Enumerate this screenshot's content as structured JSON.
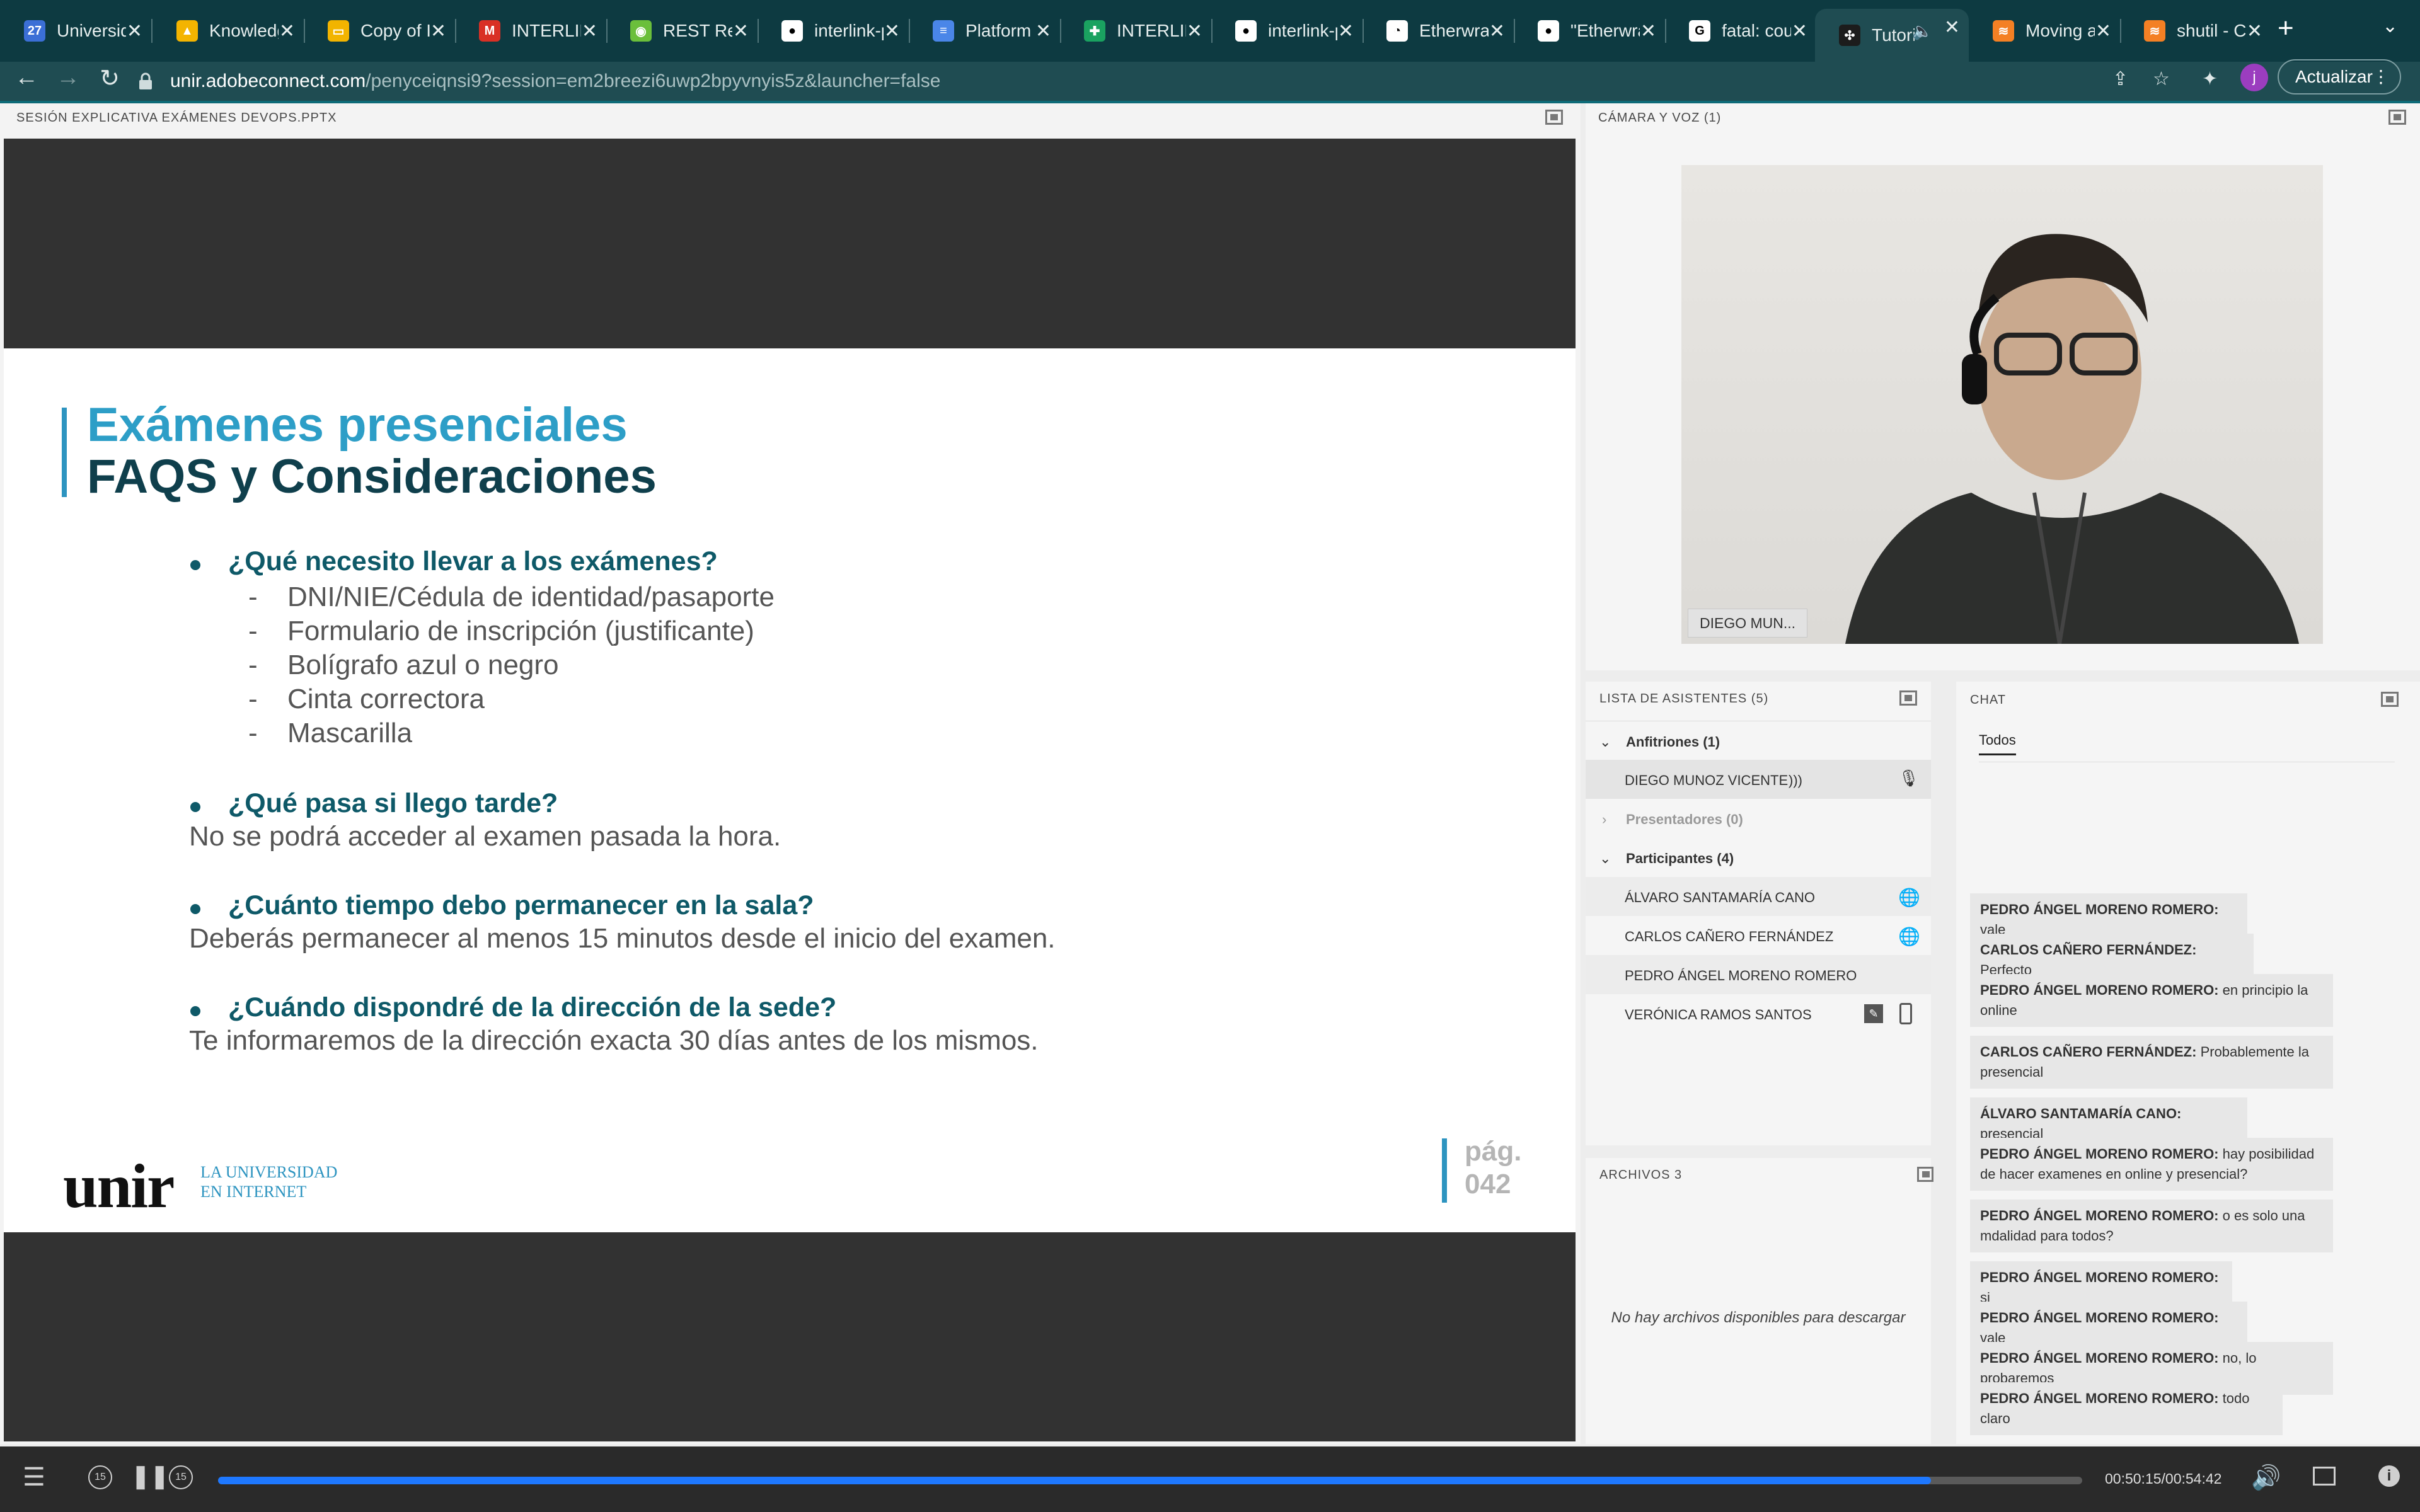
{
  "browser": {
    "tabs": [
      {
        "title": "Universidad",
        "color": "#3b6fd6",
        "glyph": "27"
      },
      {
        "title": "Knowledge",
        "color": "#f4b400",
        "glyph": "▲"
      },
      {
        "title": "Copy of ID",
        "color": "#f2b400",
        "glyph": "▭"
      },
      {
        "title": "INTERLINK",
        "color": "#d93025",
        "glyph": "M"
      },
      {
        "title": "REST Res",
        "color": "#6bbf3b",
        "glyph": "◉"
      },
      {
        "title": "interlink-p",
        "color": "#ffffff",
        "glyph": "●"
      },
      {
        "title": "Platform",
        "color": "#4a86e8",
        "glyph": "≡"
      },
      {
        "title": "INTERLINK",
        "color": "#1aa260",
        "glyph": "✚"
      },
      {
        "title": "interlink-p",
        "color": "#ffffff",
        "glyph": "●"
      },
      {
        "title": "Etherwrap",
        "color": "#ffffff",
        "glyph": "◔"
      },
      {
        "title": "\"Etherwra",
        "color": "#ffffff",
        "glyph": "●"
      },
      {
        "title": "fatal: cou",
        "color": "#ffffff",
        "glyph": "G"
      },
      {
        "title": "Tutoria",
        "color": "#1c1c1c",
        "glyph": "✣",
        "active": true
      },
      {
        "title": "Moving al",
        "color": "#f48024",
        "glyph": "≋"
      },
      {
        "title": "shutil - C",
        "color": "#f48024",
        "glyph": "≋"
      }
    ],
    "close_glyph": "✕",
    "new_tab_glyph": "+",
    "url_host": "unir.adobeconnect.com",
    "url_path": "/penyceiqnsi9?session=em2breezi6uwp2bpyvnyis5z&launcher=false",
    "avatar_letter": "j",
    "update_label": "Actualizar"
  },
  "slide_panel": {
    "title": "SESIÓN EXPLICATIVA EXÁMENES DEVOPS.PPTX"
  },
  "slide": {
    "title1": "Exámenes presenciales",
    "title2": "FAQS y Consideraciones",
    "q1": "¿Qué necesito llevar a los exámenes?",
    "items": [
      "DNI/NIE/Cédula de identidad/pasaporte",
      "Formulario de inscripción (justificante)",
      "Bolígrafo azul o negro",
      "Cinta correctora",
      "Mascarilla"
    ],
    "dash": "-",
    "q2": "¿Qué pasa si llego tarde?",
    "a2": "No se podrá acceder al examen pasada la hora.",
    "q3": "¿Cuánto tiempo debo permanecer en la sala?",
    "a3": "Deberás permanecer al menos 15 minutos desde el inicio del examen.",
    "q4": "¿Cuándo dispondré de la dirección de la sede?",
    "a4": "Te informaremos de la dirección exacta 30 días antes de los mismos.",
    "logo": "unir",
    "logo_line1": "LA UNIVERSIDAD",
    "logo_line2": "EN INTERNET",
    "page_label": "pág.",
    "page_number": "042"
  },
  "camera": {
    "title": "CÁMARA Y VOZ (1)",
    "name_tag": "DIEGO MUN..."
  },
  "attendees": {
    "title": "LISTA DE ASISTENTES  (5)",
    "hosts_label": "Anfitriones (1)",
    "host": "DIEGO MUNOZ VICENTE",
    "presenters_label": "Presentadores (0)",
    "participants_label": "Participantes (4)",
    "participants": [
      "ÁLVARO SANTAMARÍA CANO",
      "CARLOS CAÑERO FERNÁNDEZ",
      "PEDRO ÁNGEL MORENO ROMERO",
      "VERÓNICA RAMOS SANTOS"
    ]
  },
  "files": {
    "title": "ARCHIVOS 3",
    "empty_text": "No hay archivos disponibles para descargar"
  },
  "chat": {
    "title": "CHAT",
    "tab": "Todos",
    "messages": [
      {
        "author": "PEDRO ÁNGEL MORENO ROMERO:",
        "text": " vale"
      },
      {
        "author": "CARLOS CAÑERO FERNÁNDEZ:",
        "text": " Perfecto"
      },
      {
        "author": "PEDRO ÁNGEL MORENO ROMERO:",
        "text": " en principio la online"
      },
      {
        "author": "CARLOS CAÑERO FERNÁNDEZ:",
        "text": " Probablemente la presencial"
      },
      {
        "author": "ÁLVARO SANTAMARÍA CANO:",
        "text": " presencial"
      },
      {
        "author": "PEDRO ÁNGEL MORENO ROMERO:",
        "text": " hay posibilidad de hacer examenes en online y presencial?"
      },
      {
        "author": "PEDRO ÁNGEL MORENO ROMERO:",
        "text": " o es solo una mdalidad para todos?"
      },
      {
        "author": "PEDRO ÁNGEL MORENO ROMERO:",
        "text": " si"
      },
      {
        "author": "PEDRO ÁNGEL MORENO ROMERO:",
        "text": " vale"
      },
      {
        "author": "PEDRO ÁNGEL MORENO ROMERO:",
        "text": " no, lo probaremos"
      },
      {
        "author": "PEDRO ÁNGEL MORENO ROMERO:",
        "text": " todo claro"
      }
    ]
  },
  "player": {
    "time": "00:50:15/00:54:42",
    "progress": 0.9187,
    "rewind_label": "15",
    "forward_label": "15"
  }
}
